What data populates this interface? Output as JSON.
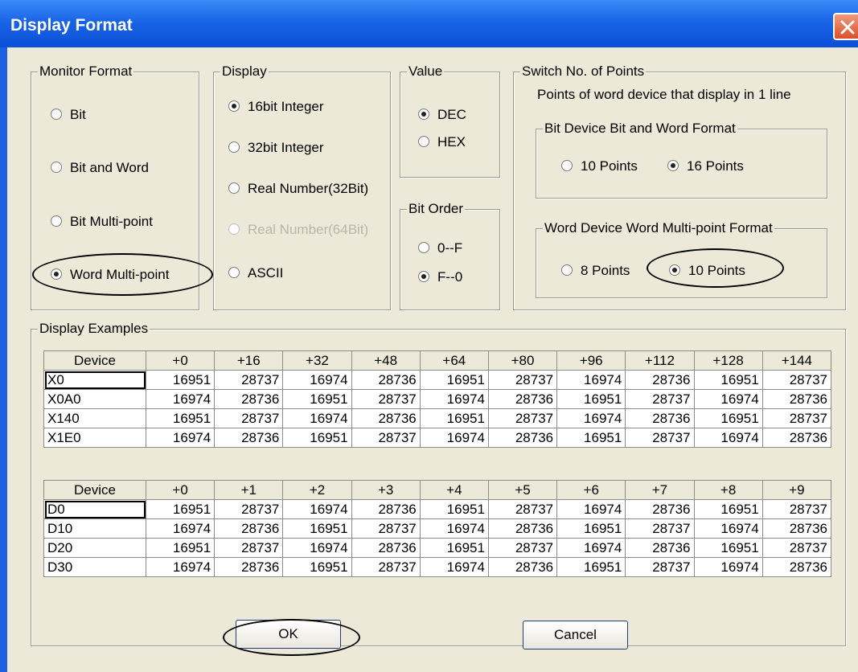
{
  "dialog": {
    "title": "Display Format"
  },
  "monitor_format": {
    "legend": "Monitor Format",
    "options": [
      "Bit",
      "Bit and Word",
      "Bit Multi-point",
      "Word Multi-point"
    ],
    "selected": "Word Multi-point"
  },
  "display": {
    "legend": "Display",
    "options": [
      "16bit Integer",
      "32bit Integer",
      "Real Number(32Bit)",
      "Real Number(64Bit)",
      "ASCII"
    ],
    "selected": "16bit Integer",
    "disabled": [
      "Real Number(64Bit)"
    ]
  },
  "value": {
    "legend": "Value",
    "options": [
      "DEC",
      "HEX"
    ],
    "selected": "DEC"
  },
  "bit_order": {
    "legend": "Bit Order",
    "options": [
      "0--F",
      "F--0"
    ],
    "selected": "F--0"
  },
  "switch_points": {
    "legend": "Switch No. of Points",
    "caption": "Points of word device that display in 1 line",
    "bit_device": {
      "legend": "Bit Device  Bit and Word Format",
      "options": [
        "10 Points",
        "16 Points"
      ],
      "selected": "16 Points"
    },
    "word_device": {
      "legend": "Word Device  Word Multi-point Format",
      "options": [
        "8 Points",
        "10 Points"
      ],
      "selected": "10 Points"
    }
  },
  "examples": {
    "legend": "Display Examples",
    "table1": {
      "headers": [
        "Device",
        "+0",
        "+16",
        "+32",
        "+48",
        "+64",
        "+80",
        "+96",
        "+112",
        "+128",
        "+144"
      ],
      "rows": [
        [
          "X0",
          "16951",
          "28737",
          "16974",
          "28736",
          "16951",
          "28737",
          "16974",
          "28736",
          "16951",
          "28737"
        ],
        [
          "X0A0",
          "16974",
          "28736",
          "16951",
          "28737",
          "16974",
          "28736",
          "16951",
          "28737",
          "16974",
          "28736"
        ],
        [
          "X140",
          "16951",
          "28737",
          "16974",
          "28736",
          "16951",
          "28737",
          "16974",
          "28736",
          "16951",
          "28737"
        ],
        [
          "X1E0",
          "16974",
          "28736",
          "16951",
          "28737",
          "16974",
          "28736",
          "16951",
          "28737",
          "16974",
          "28736"
        ]
      ]
    },
    "table2": {
      "headers": [
        "Device",
        "+0",
        "+1",
        "+2",
        "+3",
        "+4",
        "+5",
        "+6",
        "+7",
        "+8",
        "+9"
      ],
      "rows": [
        [
          "D0",
          "16951",
          "28737",
          "16974",
          "28736",
          "16951",
          "28737",
          "16974",
          "28736",
          "16951",
          "28737"
        ],
        [
          "D10",
          "16974",
          "28736",
          "16951",
          "28737",
          "16974",
          "28736",
          "16951",
          "28737",
          "16974",
          "28736"
        ],
        [
          "D20",
          "16951",
          "28737",
          "16974",
          "28736",
          "16951",
          "28737",
          "16974",
          "28736",
          "16951",
          "28737"
        ],
        [
          "D30",
          "16974",
          "28736",
          "16951",
          "28737",
          "16974",
          "28736",
          "16951",
          "28737",
          "16974",
          "28736"
        ]
      ]
    }
  },
  "buttons": {
    "ok": "OK",
    "cancel": "Cancel"
  },
  "icons": {
    "close": "close-icon",
    "radio": "radio-button-icon"
  }
}
